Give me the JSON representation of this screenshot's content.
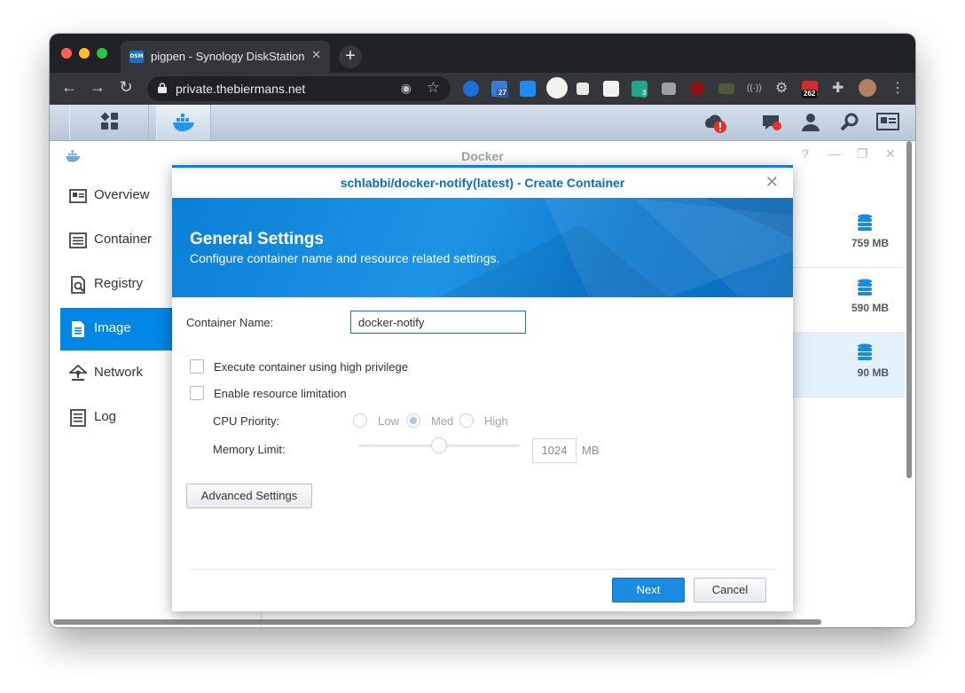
{
  "browser": {
    "tab_title": "pigpen - Synology DiskStation",
    "tab_favicon": "DSM",
    "url": "private.thebiermans.net",
    "extension_badges": [
      "27",
      "3",
      "262"
    ],
    "new_tab_label": "+"
  },
  "app": {
    "title": "Docker",
    "nav": [
      {
        "label": "Overview",
        "icon": "overview-icon"
      },
      {
        "label": "Container",
        "icon": "container-icon"
      },
      {
        "label": "Registry",
        "icon": "registry-icon"
      },
      {
        "label": "Image",
        "icon": "image-icon",
        "active": true
      },
      {
        "label": "Network",
        "icon": "network-icon"
      },
      {
        "label": "Log",
        "icon": "log-icon"
      }
    ],
    "image_sizes": [
      "759 MB",
      "590 MB",
      "90 MB"
    ]
  },
  "dialog": {
    "title": "schlabbi/docker-notify(latest) - Create Container",
    "banner_heading": "General Settings",
    "banner_sub": "Configure container name and resource related settings.",
    "container_name_label": "Container Name:",
    "container_name_value": "docker-notify",
    "high_privilege_label": "Execute container using high privilege",
    "high_privilege_checked": false,
    "resource_limit_label": "Enable resource limitation",
    "resource_limit_checked": false,
    "cpu_priority_label": "CPU Priority:",
    "cpu_options": [
      "Low",
      "Med",
      "High"
    ],
    "cpu_selected": "Med",
    "memory_label": "Memory Limit:",
    "memory_value": "1024",
    "memory_unit": "MB",
    "memory_slider_fraction": 0.5,
    "advanced_label": "Advanced Settings",
    "next_label": "Next",
    "cancel_label": "Cancel"
  },
  "colors": {
    "accent": "#0086e5",
    "title_blue": "#0a6fb8",
    "chrome_dark": "#202124"
  }
}
